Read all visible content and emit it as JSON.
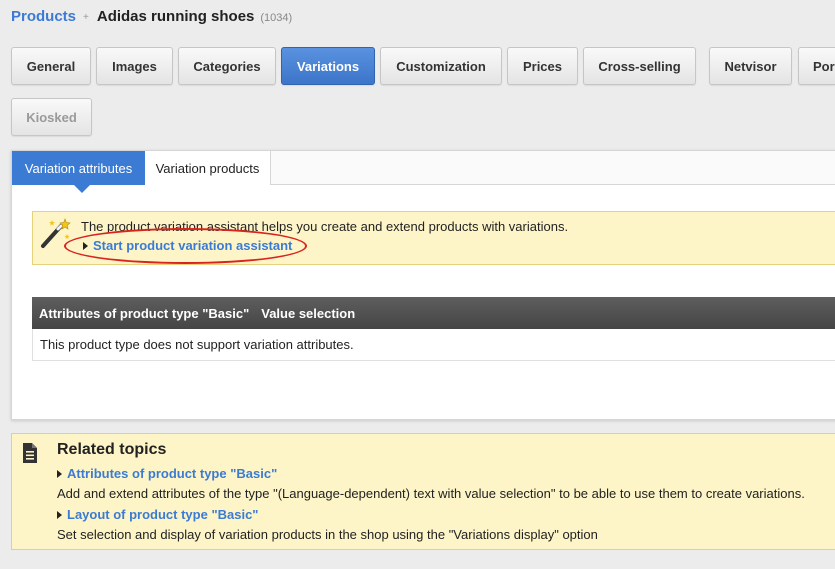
{
  "breadcrumb": {
    "root": "Products",
    "separator": "+",
    "title": "Adidas running shoes",
    "count": "(1034)"
  },
  "tabs": [
    {
      "label": "General",
      "state": "normal"
    },
    {
      "label": "Images",
      "state": "normal"
    },
    {
      "label": "Categories",
      "state": "normal"
    },
    {
      "label": "Variations",
      "state": "active"
    },
    {
      "label": "Customization",
      "state": "normal"
    },
    {
      "label": "Prices",
      "state": "normal"
    },
    {
      "label": "Cross-selling",
      "state": "normal"
    },
    {
      "label": "Netvisor",
      "state": "normal"
    },
    {
      "label": "Por",
      "state": "normal"
    },
    {
      "label": "Kiosked",
      "state": "disabled"
    }
  ],
  "subtabs": [
    {
      "label": "Variation attributes",
      "active": true
    },
    {
      "label": "Variation products",
      "active": false
    }
  ],
  "assistant": {
    "icon": "magic-wand-icon",
    "text": "The product variation assistant helps you create and extend products with variations.",
    "link": "Start product variation assistant",
    "highlight_color": "#d9231d"
  },
  "attributes_table": {
    "headers": [
      "Attributes of product type \"Basic\"",
      "Value selection"
    ],
    "message": "This product type does not support variation attributes."
  },
  "related": {
    "icon": "document-icon",
    "title": "Related topics",
    "items": [
      {
        "link": "Attributes of product type \"Basic\"",
        "description": "Add and extend attributes of the type \"(Language-dependent) text with value selection\" to be able to use them to create variations."
      },
      {
        "link": "Layout of product type \"Basic\"",
        "description": "Set selection and display of variation products in the shop using the \"Variations display\" option"
      }
    ]
  },
  "colors": {
    "accent": "#3b7bd4",
    "info_bg": "#fdf5c8",
    "table_header": "#4f4f4f"
  }
}
